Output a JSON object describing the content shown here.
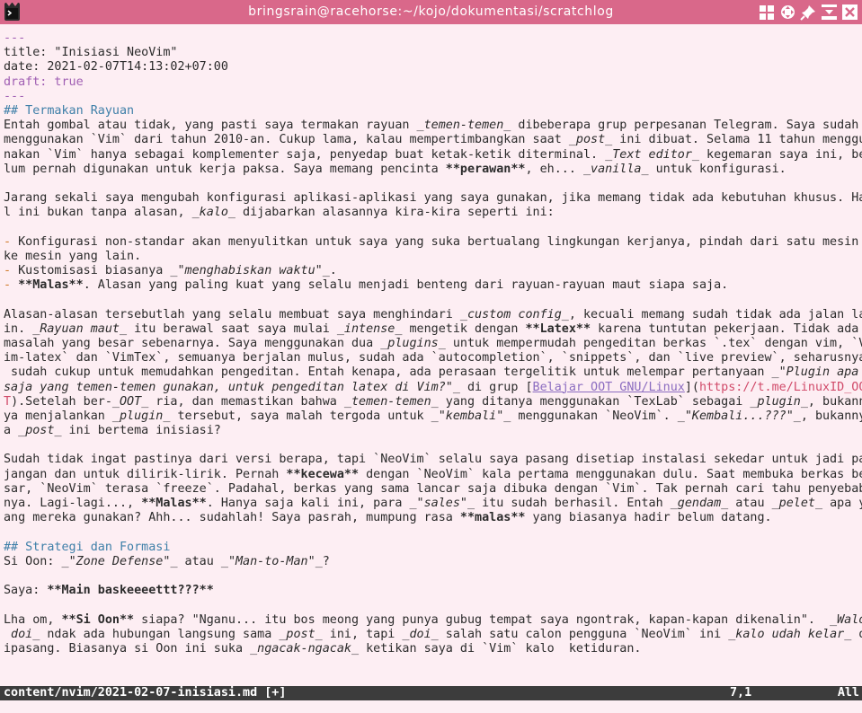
{
  "window": {
    "title": "bringsrain@racehorse:~/kojo/dokumentasi/scratchlog",
    "buttons": [
      "layout-grid-icon",
      "move-icon",
      "pin-icon",
      "minimize-icon",
      "close-icon"
    ]
  },
  "colors": {
    "titlebar": "#d9688a",
    "background": "#fdeef3",
    "frontmatter": "#a05fb3",
    "heading": "#3e7fa8",
    "bullet": "#d07a2a",
    "link": "#8b6cc0",
    "url": "#d14b6a",
    "statusline": "#3c3c3c"
  },
  "editor": {
    "lines": [
      [
        [
          "---",
          "fm"
        ]
      ],
      [
        [
          "title: \"Inisiasi NeoVim\"",
          ""
        ]
      ],
      [
        [
          "date: 2021-02-07T14:13:02+07:00",
          ""
        ]
      ],
      [
        [
          "draft: true",
          "fm"
        ]
      ],
      [
        [
          "---",
          "fm"
        ]
      ],
      [
        [
          "## Termakan Rayuan",
          "head"
        ]
      ],
      [
        [
          "Entah gombal atau tidak, yang pasti saya termakan rayuan _",
          ""
        ],
        [
          "temen-temen",
          "it"
        ],
        [
          "_ dibeberapa grup perpesanan Telegram. Saya sudah",
          ""
        ]
      ],
      [
        [
          "menggunakan `Vim` dari tahun 2010-an. Cukup lama, kalau mempertimbangkan saat _",
          ""
        ],
        [
          "post",
          "it"
        ],
        [
          "_ ini dibuat. Selama 11 tahun menggu",
          ""
        ]
      ],
      [
        [
          "nakan `Vim` hanya sebagai komplementer saja, penyedap buat ketak-ketik diterminal. _",
          ""
        ],
        [
          "Text editor",
          "it"
        ],
        [
          "_ kegemaran saya ini, be",
          ""
        ]
      ],
      [
        [
          "lum pernah digunakan untuk kerja paksa. Saya memang pencinta ",
          ""
        ],
        [
          "**perawan**",
          "bd"
        ],
        [
          ", eh... _",
          ""
        ],
        [
          "vanilla",
          "it"
        ],
        [
          "_ untuk konfigurasi.",
          ""
        ]
      ],
      [
        [
          "",
          ""
        ]
      ],
      [
        [
          "Jarang sekali saya mengubah konfigurasi aplikasi-aplikasi yang saya gunakan, jika memang tidak ada kebutuhan khusus. Ha",
          ""
        ]
      ],
      [
        [
          "l ini bukan tanpa alasan, _",
          ""
        ],
        [
          "kalo",
          "it"
        ],
        [
          "_ dijabarkan alasannya kira-kira seperti ini:",
          ""
        ]
      ],
      [
        [
          "",
          ""
        ]
      ],
      [
        [
          "-",
          "bullet"
        ],
        [
          " Konfigurasi non-standar akan menyulitkan untuk saya yang suka bertualang lingkungan kerjanya, pindah dari satu mesin",
          ""
        ]
      ],
      [
        [
          "ke mesin yang lain.",
          ""
        ]
      ],
      [
        [
          "-",
          "bullet"
        ],
        [
          " Kustomisasi biasanya _",
          ""
        ],
        [
          "\"menghabiskan waktu\"",
          "it"
        ],
        [
          "_.",
          ""
        ]
      ],
      [
        [
          "-",
          "bullet"
        ],
        [
          " ",
          ""
        ],
        [
          "**Malas**",
          "bd"
        ],
        [
          ". Alasan yang paling kuat yang selalu menjadi benteng dari rayuan-rayuan maut siapa saja.",
          ""
        ]
      ],
      [
        [
          "",
          ""
        ]
      ],
      [
        [
          "Alasan-alasan tersebutlah yang selalu membuat saya menghindari _",
          ""
        ],
        [
          "custom config",
          "it"
        ],
        [
          "_, kecuali memang sudah tidak ada jalan la",
          ""
        ]
      ],
      [
        [
          "in. _",
          ""
        ],
        [
          "Rayuan maut",
          "it"
        ],
        [
          "_ itu berawal saat saya mulai _",
          ""
        ],
        [
          "intense",
          "it"
        ],
        [
          "_ mengetik dengan ",
          ""
        ],
        [
          "**Latex**",
          "bd"
        ],
        [
          " karena tuntutan pekerjaan. Tidak ada",
          ""
        ]
      ],
      [
        [
          "masalah yang besar sebenarnya. Saya menggunakan dua _",
          ""
        ],
        [
          "plugins",
          "it"
        ],
        [
          "_ untuk mempermudah pengeditan berkas `.tex` dengan vim, `V",
          ""
        ]
      ],
      [
        [
          "im-latex` dan `VimTex`, semuanya berjalan mulus, sudah ada `autocompletion`, `snippets`, dan `live preview`, seharusnya",
          ""
        ]
      ],
      [
        [
          " sudah cukup untuk memudahkan pengeditan. Entah kenapa, ada perasaan tergelitik untuk melempar pertanyaan _",
          ""
        ],
        [
          "\"Plugin apa",
          "it"
        ]
      ],
      [
        [
          "saja yang temen-temen gunakan, untuk pengeditan latex di Vim?\"",
          "it"
        ],
        [
          "_ di grup [",
          ""
        ],
        [
          "Belajar OOT GNU/Linux",
          "link"
        ],
        [
          "](",
          ""
        ],
        [
          "https://t.me/LinuxID_OO",
          "url"
        ]
      ],
      [
        [
          "T",
          "url"
        ],
        [
          ").Setelah ber-_",
          ""
        ],
        [
          "OOT",
          "it"
        ],
        [
          "_ ria, dan memastikan bahwa _",
          ""
        ],
        [
          "temen-temen",
          "it"
        ],
        [
          "_ yang ditanya menggunakan `TexLab` sebagai _",
          ""
        ],
        [
          "plugin",
          "it"
        ],
        [
          "_, bukann",
          ""
        ]
      ],
      [
        [
          "ya menjalankan _",
          ""
        ],
        [
          "plugin",
          "it"
        ],
        [
          "_ tersebut, saya malah tergoda untuk _",
          ""
        ],
        [
          "\"kembali\"",
          "it"
        ],
        [
          "_ menggunakan `NeoVim`. _",
          ""
        ],
        [
          "\"Kembali...???\"",
          "it"
        ],
        [
          "_, bukanny",
          ""
        ]
      ],
      [
        [
          "a _",
          ""
        ],
        [
          "post",
          "it"
        ],
        [
          "_ ini bertema inisiasi?",
          ""
        ]
      ],
      [
        [
          "",
          ""
        ]
      ],
      [
        [
          "Sudah tidak ingat pastinya dari versi berapa, tapi `NeoVim` selalu saya pasang disetiap instalasi sekedar untuk jadi pa",
          ""
        ]
      ],
      [
        [
          "jangan dan untuk dilirik-lirik. Pernah ",
          ""
        ],
        [
          "**kecewa**",
          "bd"
        ],
        [
          " dengan `NeoVim` kala pertama menggunakan dulu. Saat membuka berkas be",
          ""
        ]
      ],
      [
        [
          "sar, `NeoVim` terasa `freeze`. Padahal, berkas yang sama lancar saja dibuka dengan `Vim`. Tak pernah cari tahu penyebab",
          ""
        ]
      ],
      [
        [
          "nya. Lagi-lagi..., ",
          ""
        ],
        [
          "**Malas**",
          "bd"
        ],
        [
          ". Hanya saja kali ini, para _",
          ""
        ],
        [
          "\"sales\"",
          "it"
        ],
        [
          "_ itu sudah berhasil. Entah _",
          ""
        ],
        [
          "gendam",
          "it"
        ],
        [
          "_ atau _",
          ""
        ],
        [
          "pelet",
          "it"
        ],
        [
          "_ apa y",
          ""
        ]
      ],
      [
        [
          "ang mereka gunakan? Ahh... sudahlah! Saya pasrah, mumpung rasa ",
          ""
        ],
        [
          "**malas**",
          "bd"
        ],
        [
          " yang biasanya hadir belum datang.",
          ""
        ]
      ],
      [
        [
          "",
          ""
        ]
      ],
      [
        [
          "## Strategi dan Formasi",
          "head"
        ]
      ],
      [
        [
          "Si Oon: _",
          ""
        ],
        [
          "\"Zone Defense\"",
          "it"
        ],
        [
          "_ atau _",
          ""
        ],
        [
          "\"Man-to-Man\"",
          "it"
        ],
        [
          "_?",
          ""
        ]
      ],
      [
        [
          "",
          ""
        ]
      ],
      [
        [
          "Saya: ",
          ""
        ],
        [
          "**Main baskeeeettt???**",
          "bd"
        ]
      ],
      [
        [
          "",
          ""
        ]
      ],
      [
        [
          "Lha om, ",
          ""
        ],
        [
          "**Si Oon**",
          "bd"
        ],
        [
          " siapa? \"Nganu... itu bos meong yang punya gubug tempat saya ngontrak, kapan-kapan dikenalin\".  _",
          ""
        ],
        [
          "Walo",
          "it"
        ]
      ],
      [
        [
          " doi",
          "it"
        ],
        [
          "_ ndak ada hubungan langsung sama _",
          ""
        ],
        [
          "post",
          "it"
        ],
        [
          "_ ini, tapi _",
          ""
        ],
        [
          "doi",
          "it"
        ],
        [
          "_ salah satu calon pengguna `NeoVim` ini _",
          ""
        ],
        [
          "kalo udah kelar",
          "it"
        ],
        [
          "_ d",
          ""
        ]
      ],
      [
        [
          "ipasang. Biasanya si Oon ini suka _",
          ""
        ],
        [
          "ngacak-ngacak",
          "it"
        ],
        [
          "_ ketikan saya di `Vim` kalo  ketiduran.",
          ""
        ]
      ],
      [
        [
          "",
          ""
        ]
      ],
      [
        [
          "",
          ""
        ]
      ],
      [
        [
          "~",
          "tilde"
        ]
      ],
      [
        [
          "~",
          "tilde"
        ]
      ]
    ]
  },
  "status": {
    "file": "content/nvim/2021-02-07-inisiasi.md [+]",
    "position": "7,1",
    "scroll": "All"
  }
}
